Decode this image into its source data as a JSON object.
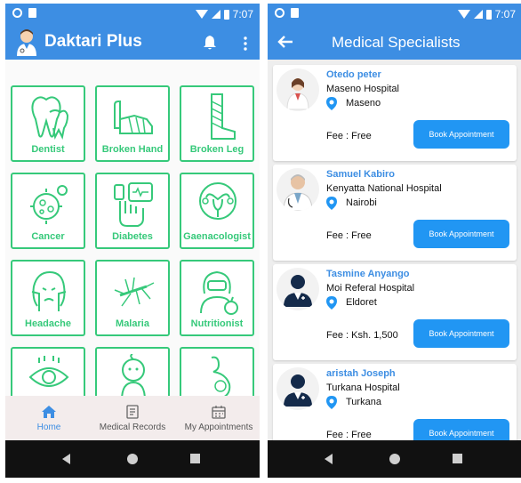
{
  "status_bar": {
    "time": "7:07"
  },
  "left_screen": {
    "app_title": "Daktari Plus",
    "specialties": [
      {
        "label": "Dentist",
        "icon": "tooth-icon"
      },
      {
        "label": "Broken Hand",
        "icon": "broken-hand-icon"
      },
      {
        "label": "Broken Leg",
        "icon": "broken-leg-icon"
      },
      {
        "label": "Cancer",
        "icon": "cancer-cell-icon"
      },
      {
        "label": "Diabetes",
        "icon": "diabetes-icon"
      },
      {
        "label": "Gaenacologist",
        "icon": "uterus-icon"
      },
      {
        "label": "Headache",
        "icon": "headache-icon"
      },
      {
        "label": "Malaria",
        "icon": "mosquito-icon"
      },
      {
        "label": "Nutritionist",
        "icon": "nutritionist-icon"
      },
      {
        "label": "",
        "icon": "eye-icon"
      },
      {
        "label": "",
        "icon": "baby-icon"
      },
      {
        "label": "",
        "icon": "pregnancy-icon"
      }
    ],
    "bottom_nav": [
      {
        "label": "Home",
        "icon": "home-icon",
        "active": true
      },
      {
        "label": "Medical Records",
        "icon": "records-icon",
        "active": false
      },
      {
        "label": "My Appointments",
        "icon": "calendar-icon",
        "active": false
      }
    ]
  },
  "right_screen": {
    "title": "Medical Specialists",
    "doctors": [
      {
        "name": "Otedo peter",
        "hospital": "Maseno Hospital",
        "location": "Maseno",
        "fee": "Fee :  Free",
        "button": "Book Appointment",
        "avatar": "doctor-female-icon"
      },
      {
        "name": "Samuel Kabiro",
        "hospital": "Kenyatta National Hospital",
        "location": "Nairobi",
        "fee": "Fee :  Free",
        "button": "Book Appointment",
        "avatar": "doctor-photo-icon"
      },
      {
        "name": "Tasmine Anyango",
        "hospital": "Moi Referal Hospital",
        "location": "Eldoret",
        "fee": "Fee :  Ksh. 1,500",
        "button": "Book Appointment",
        "avatar": "doctor-silhouette-icon"
      },
      {
        "name": "aristah Joseph",
        "hospital": "Turkana Hospital",
        "location": "Turkana",
        "fee": "Fee :  Free",
        "button": "Book Appointment",
        "avatar": "doctor-silhouette-icon"
      }
    ]
  },
  "colors": {
    "primary": "#3d8ee3",
    "accent_green": "#36c97a",
    "button_blue": "#2196f3"
  }
}
